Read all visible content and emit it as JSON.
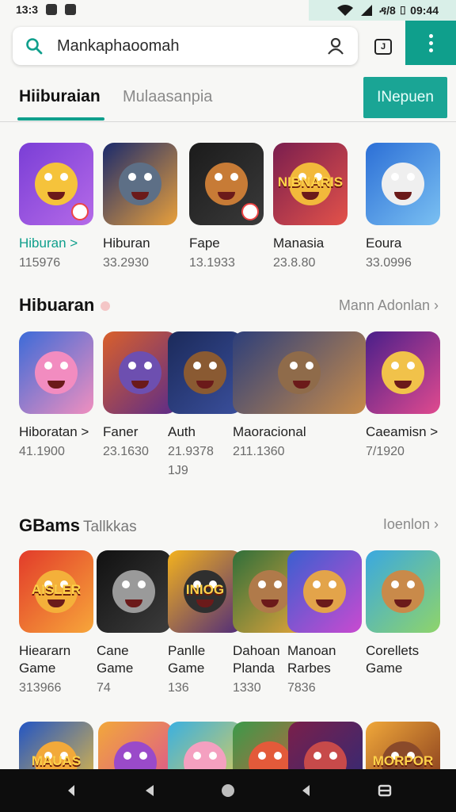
{
  "status_bar": {
    "time": "13:3",
    "right_text": "ዳ/8 ▯ 09:44",
    "accent_color": "#d9efe8"
  },
  "search": {
    "text": "Mankaphaoomah",
    "search_icon": "search-icon",
    "account_icon": "account-icon"
  },
  "toolbar": {
    "square_icon_label": "J",
    "menu_icon": "more-vert-icon",
    "accent_color": "#0f9f8c"
  },
  "tabs": {
    "active": "Hiiburaian",
    "inactive": "Mulaasanpia",
    "button": "INepuen"
  },
  "row1": [
    {
      "name": "Hiburan >",
      "count": "115976",
      "colors": [
        "#7a3ed6",
        "#b56ae8"
      ],
      "face": "#f5c33b",
      "badge": true,
      "teal": true
    },
    {
      "name": "Hiburan",
      "count": "33.2930",
      "colors": [
        "#1a2a6c",
        "#e9a03b"
      ],
      "face": "#5d6f86",
      "badge": false,
      "teal": false
    },
    {
      "name": "Fape",
      "count": "13.1933",
      "colors": [
        "#1b1b1b",
        "#3a3a3a"
      ],
      "face": "#c77b36",
      "badge": true,
      "teal": false
    },
    {
      "name": "Manasia",
      "count": "23.8.80",
      "colors": [
        "#7a1e4e",
        "#e3524a"
      ],
      "face": "#f2b93b",
      "badge": false,
      "teal": false,
      "label": "NIBNARIS"
    },
    {
      "name": "Eoura",
      "count": "33.0996",
      "colors": [
        "#2c6fd6",
        "#7ac0f2"
      ],
      "face": "#efefef",
      "badge": false,
      "teal": false
    }
  ],
  "section1": {
    "title": "Hibuaran",
    "more": "Mann Adonlan"
  },
  "row2": [
    {
      "name": "Hiboratan >",
      "count": "41.1900",
      "count2": "",
      "colors": [
        "#3c6bd8",
        "#f08fbf"
      ],
      "face": "#f28cc0"
    },
    {
      "name": "Faner",
      "count": "23.1630",
      "count2": "",
      "colors": [
        "#d9602b",
        "#5b2b8a"
      ],
      "face": "#6d4fb0"
    },
    {
      "name": "Auth",
      "count": "21.9378",
      "count2": "1J9",
      "colors": [
        "#1b2a5a",
        "#3a4f9c"
      ],
      "face": "#8a5a32"
    },
    {
      "name": "Maoracional",
      "count": "211.1360",
      "count2": "",
      "colors": [
        "#2d3f7a",
        "#c78b4a"
      ],
      "face": "#8f6b4a",
      "wide": true
    },
    {
      "name": "Caeamisn >",
      "count": "7/1920",
      "count2": "",
      "colors": [
        "#4a1f8a",
        "#e04a8f"
      ],
      "face": "#f1c24a"
    }
  ],
  "section2": {
    "title": "GBams",
    "subtitle": "Tallkkas",
    "more": "Ioenlon"
  },
  "row3": [
    {
      "name": "Hieararn",
      "name2": "Game",
      "count": "313966",
      "colors": [
        "#e23b2a",
        "#f7a63a"
      ],
      "face": "#f4b03a",
      "label": "AISLER",
      "mark": "n"
    },
    {
      "name": "Cane",
      "name2": "Game",
      "count": "74",
      "colors": [
        "#111111",
        "#3c3c3c"
      ],
      "face": "#9a9a9a"
    },
    {
      "name": "Panlle",
      "name2": "Game",
      "count": "136",
      "colors": [
        "#f3b21e",
        "#4f2b7a"
      ],
      "face": "#2f2f2f",
      "label": "INIOG"
    },
    {
      "name": "Dahoan",
      "name2": "Planda",
      "count": "1330",
      "colors": [
        "#2f6f3a",
        "#e3a43a"
      ],
      "face": "#b07a4a"
    },
    {
      "name": "Manoan",
      "name2": "Rarbes",
      "count": "7836",
      "colors": [
        "#3a5fd0",
        "#c94ad0"
      ],
      "face": "#e3a44a"
    },
    {
      "name": "Corellets",
      "name2": "Game",
      "count": "",
      "colors": [
        "#3aa8e0",
        "#8fd46a"
      ],
      "face": "#c98a4a"
    }
  ],
  "row4": [
    {
      "colors": [
        "#2255c4",
        "#f2c23a"
      ],
      "face": "#f2a93a",
      "label": "MAUAS"
    },
    {
      "colors": [
        "#f2a83a",
        "#d94a9a"
      ],
      "face": "#9a4ac9"
    },
    {
      "colors": [
        "#3ab0e0",
        "#f0d04a"
      ],
      "face": "#f4a0c0"
    },
    {
      "colors": [
        "#3a9a4a",
        "#e0573a"
      ],
      "face": "#e35a3a"
    },
    {
      "colors": [
        "#7a1f4a",
        "#2b2b7a"
      ],
      "face": "#c74a4a"
    },
    {
      "colors": [
        "#f0a83a",
        "#7a2f1a"
      ],
      "face": "#8a4a2a",
      "label": "MORPOR"
    }
  ]
}
